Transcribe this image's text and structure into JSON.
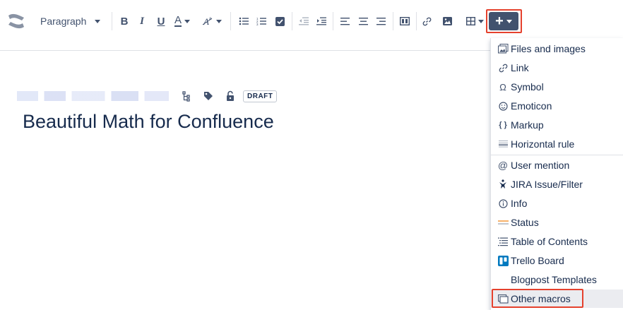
{
  "toolbar": {
    "paragraph_label": "Paragraph",
    "bold_label": "B",
    "italic_label": "I",
    "underline_label": "U",
    "text_color_label": "A",
    "plus_label": "+"
  },
  "page": {
    "status": "DRAFT",
    "title": "Beautiful Math for Confluence"
  },
  "insert_menu": {
    "items": [
      {
        "label": "Files and images",
        "icon": "files-images-icon"
      },
      {
        "label": "Link",
        "icon": "link-icon"
      },
      {
        "label": "Symbol",
        "icon": "omega-icon"
      },
      {
        "label": "Emoticon",
        "icon": "smiley-icon"
      },
      {
        "label": "Markup",
        "icon": "braces-icon"
      },
      {
        "label": "Horizontal rule",
        "icon": "horizontal-rule-icon"
      },
      {
        "label": "User mention",
        "icon": "at-icon"
      },
      {
        "label": "JIRA Issue/Filter",
        "icon": "jira-icon"
      },
      {
        "label": "Info",
        "icon": "info-icon"
      },
      {
        "label": "Status",
        "icon": "status-icon"
      },
      {
        "label": "Table of Contents",
        "icon": "toc-icon"
      },
      {
        "label": "Trello Board",
        "icon": "trello-icon"
      },
      {
        "label": "Blogpost Templates",
        "icon": ""
      },
      {
        "label": "Other macros",
        "icon": "other-macros-icon"
      }
    ]
  },
  "colors": {
    "toolbar_icon": "#42526e",
    "primary_button": "#42526e",
    "highlight": "#e5412d",
    "text": "#172b4d",
    "trello": "#0079bf"
  }
}
